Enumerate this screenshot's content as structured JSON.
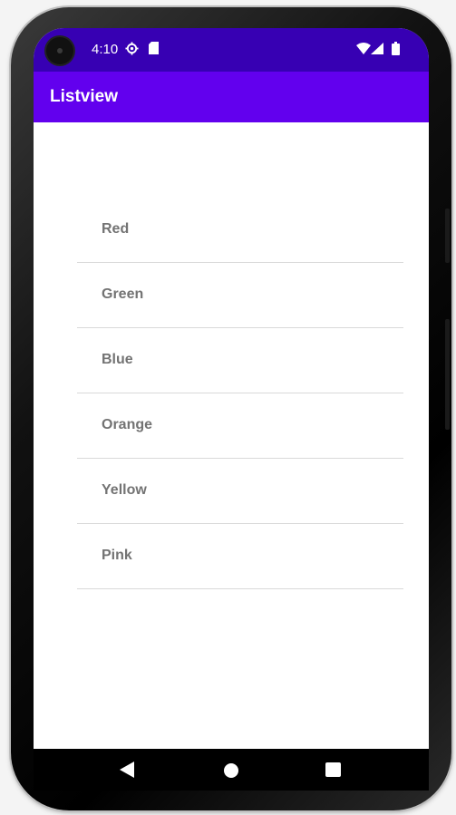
{
  "status_bar": {
    "time": "4:10",
    "icons": [
      "settings-gear-icon",
      "sd-card-icon",
      "wifi-icon",
      "cell-signal-icon",
      "battery-icon"
    ]
  },
  "app_bar": {
    "title": "Listview"
  },
  "list": {
    "items": [
      {
        "label": "Red"
      },
      {
        "label": "Green"
      },
      {
        "label": "Blue"
      },
      {
        "label": "Orange"
      },
      {
        "label": "Yellow"
      },
      {
        "label": "Pink"
      }
    ]
  },
  "nav_bar": {
    "buttons": [
      "back-icon",
      "home-icon",
      "recents-icon"
    ]
  },
  "colors": {
    "status_bar": "#3700b3",
    "app_bar": "#6200ee",
    "list_text": "#737373",
    "divider": "#d9d9d9"
  }
}
